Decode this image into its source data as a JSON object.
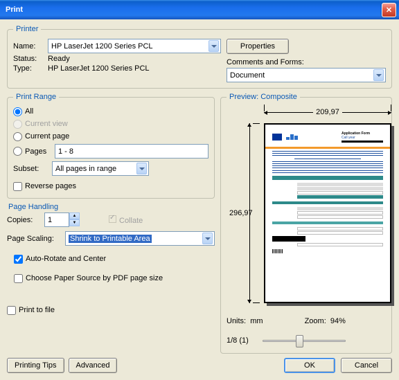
{
  "window": {
    "title": "Print"
  },
  "printer": {
    "legend": "Printer",
    "name_label": "Name:",
    "name_value": "HP LaserJet 1200 Series PCL",
    "properties_btn": "Properties",
    "status_label": "Status:",
    "status_value": "Ready",
    "type_label": "Type:",
    "type_value": "HP LaserJet 1200 Series PCL",
    "comments_label": "Comments and Forms:",
    "comments_value": "Document"
  },
  "print_range": {
    "legend": "Print Range",
    "all": "All",
    "current_view": "Current view",
    "current_page": "Current page",
    "pages": "Pages",
    "pages_value": "1 - 8",
    "subset_label": "Subset:",
    "subset_value": "All pages in range",
    "reverse": "Reverse pages"
  },
  "page_handling": {
    "legend": "Page Handling",
    "copies_label": "Copies:",
    "copies_value": "1",
    "collate": "Collate",
    "scaling_label": "Page Scaling:",
    "scaling_value": "Shrink to Printable Area",
    "auto_rotate": "Auto-Rotate and Center",
    "paper_source": "Choose Paper Source by PDF page size"
  },
  "print_to_file": "Print to file",
  "preview": {
    "legend": "Preview: Composite",
    "width": "209,97",
    "height": "296,97",
    "units_label": "Units:",
    "units_value": "mm",
    "zoom_label": "Zoom:",
    "zoom_value": "94%",
    "page_counter": "1/8 (1)",
    "doc_title": "Application Form",
    "doc_sub": "Call year"
  },
  "buttons": {
    "printing_tips": "Printing Tips",
    "advanced": "Advanced",
    "ok": "OK",
    "cancel": "Cancel"
  }
}
